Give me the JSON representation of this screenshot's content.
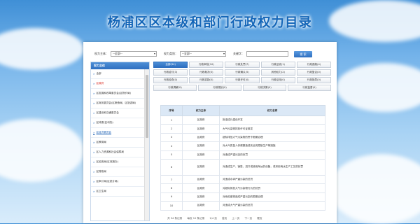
{
  "title": "杨浦区区本级和部门行政权力目录",
  "filters": {
    "category_label": "权力主体：",
    "category_value": "--全部--",
    "type_label": "权力类别：",
    "type_value": "--全部--",
    "keyword_label": "关键字：",
    "search_button": "搜 索"
  },
  "sidebar": {
    "header": "权力主体",
    "items": [
      "全部",
      "区政府",
      "区发展和改革委员会(区物价局)",
      "区商务委员会(区粮食局、区旅游局)",
      "区建设和交通委员会",
      "区科委(区科协)",
      "区经济委员会",
      "区教育局",
      "区人力资源和社会保障局",
      "区民政局(区双拥办)",
      "区财政局",
      "区审计局(区统计局)",
      "区卫生局"
    ]
  },
  "tabs": [
    [
      "全部(34)",
      "行政审批(10)",
      "行政处罚(7)",
      "行政征收(1)",
      "行政强制(4)"
    ],
    [
      "行政给付(3)",
      "行政裁决(0)",
      "行政确认(5)",
      "其他权力(2)",
      "行政复议(0)"
    ],
    [
      "行政检查(0)",
      "行政奖励(0)",
      "行政许可(0)",
      "行政征用(0)",
      "行政指导(0)"
    ],
    [
      "行政调解(0)",
      "行政规划(0)",
      "行政决策(0)",
      "行政监督(0)"
    ]
  ],
  "table": {
    "headers": [
      "序号",
      "权力主体",
      "权力名称"
    ],
    "rows": [
      [
        "1",
        "区政府",
        "批准成片建设开发"
      ],
      [
        "2",
        "区政府",
        "大气污染物排放许可证核发"
      ],
      [
        "3",
        "区政府",
        "超标排放大气污染物的责令限期治理"
      ],
      [
        "4",
        "区政府",
        "对大气质量人体健康造成安全的限制生产等措施"
      ],
      [
        "5",
        "区政府",
        "对造成严重污染的处罚"
      ],
      [
        "6",
        "区政府",
        "对造成生产、销售、进口或使用淘汰的设备，或采用淘汰生产工艺的处罚"
      ],
      [
        "7",
        "区政府",
        "对造成水体严重污染的处罚"
      ],
      [
        "8",
        "区政府",
        "对超标排放大气污染物行为的处罚"
      ],
      [
        "9",
        "区政府",
        "对危险废物造成严重污染的限期治理"
      ],
      [
        "10",
        "区政府",
        "对造成大气严重污染的处罚"
      ]
    ]
  },
  "pager": {
    "summary": "共 34 条记录",
    "per_page": "每页 10 条记录",
    "page": "1/4 页",
    "first": "首页",
    "prev": "上一页",
    "next": "下一页",
    "last": "尾页"
  }
}
